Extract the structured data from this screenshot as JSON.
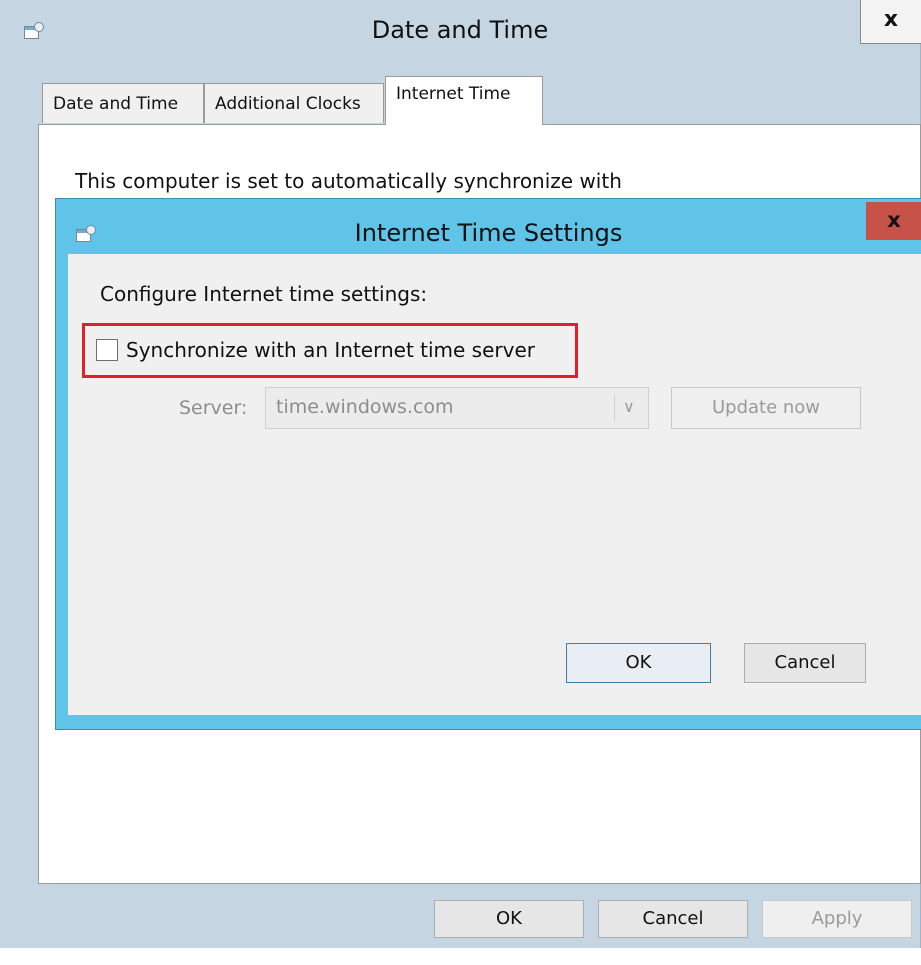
{
  "main_window": {
    "title": "Date and Time",
    "close_glyph": "x",
    "tabs": [
      {
        "label": "Date and Time"
      },
      {
        "label": "Additional Clocks"
      },
      {
        "label": "Internet Time"
      }
    ],
    "active_tab": "Internet Time",
    "panel_text": "This computer is set to automatically synchronize with",
    "buttons": {
      "ok": "OK",
      "cancel": "Cancel",
      "apply": "Apply"
    }
  },
  "dialog": {
    "title": "Internet Time Settings",
    "close_glyph": "x",
    "heading": "Configure Internet time settings:",
    "sync_checkbox": {
      "label": "Synchronize with an Internet time server",
      "checked": false
    },
    "server_label": "Server:",
    "server_value": "time.windows.com",
    "update_now": "Update now",
    "buttons": {
      "ok": "OK",
      "cancel": "Cancel"
    }
  },
  "icons": {
    "window_icon": "date-time-icon",
    "dropdown": "chevron-down-icon"
  },
  "colors": {
    "dialog_frame": "#5fc4e8",
    "dialog_close": "#c7524a",
    "main_frame": "#c5d6e2",
    "highlight": "#e0202a"
  }
}
